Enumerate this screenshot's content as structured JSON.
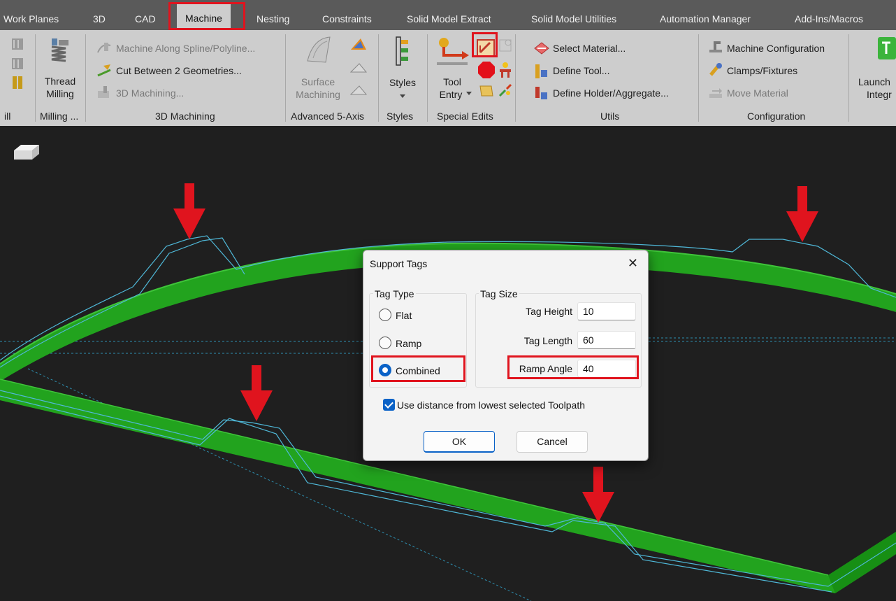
{
  "tabs": [
    "Work Planes",
    "3D",
    "CAD",
    "Machine",
    "Nesting",
    "Constraints",
    "Solid Model Extract",
    "Solid Model Utilities",
    "Automation Manager",
    "Add-Ins/Macros"
  ],
  "active_tab": "Machine",
  "ribbon": {
    "mill_fragment": "ill",
    "milling": {
      "button_line1": "Thread",
      "button_line2": "Milling",
      "group": "Milling ..."
    },
    "machining3d": {
      "items": [
        "Machine Along Spline/Polyline...",
        "Cut Between 2 Geometries...",
        "3D Machining..."
      ],
      "group": "3D Machining"
    },
    "advanced5axis": {
      "button_line1": "Surface",
      "button_line2": "Machining",
      "group": "Advanced 5-Axis"
    },
    "styles": {
      "button": "Styles",
      "group": "Styles"
    },
    "special_edits": {
      "button_line1": "Tool",
      "button_line2": "Entry",
      "group": "Special Edits"
    },
    "utils": {
      "items": [
        "Select Material...",
        "Define Tool...",
        "Define Holder/Aggregate..."
      ],
      "group": "Utils"
    },
    "configuration": {
      "items": [
        "Machine Configuration",
        "Clamps/Fixtures",
        "Move Material"
      ],
      "group": "Configuration"
    },
    "launch": {
      "line1": "Launch",
      "line2": "Integr"
    }
  },
  "dialog": {
    "title": "Support Tags",
    "tag_type": {
      "legend": "Tag Type",
      "options": [
        "Flat",
        "Ramp",
        "Combined"
      ],
      "selected": "Combined"
    },
    "tag_size": {
      "legend": "Tag Size",
      "height_label": "Tag Height",
      "height_value": "10",
      "length_label": "Tag Length",
      "length_value": "60",
      "angle_label": "Ramp Angle",
      "angle_value": "40"
    },
    "checkbox_label": "Use distance from lowest selected Toolpath",
    "checkbox_checked": true,
    "ok": "OK",
    "cancel": "Cancel"
  },
  "colors": {
    "highlight": "#e0141e",
    "part_green": "#22a31e",
    "toolpath": "#4fb8d8",
    "accent_blue": "#0a62c7",
    "viewport_bg": "#1f1f1f"
  }
}
